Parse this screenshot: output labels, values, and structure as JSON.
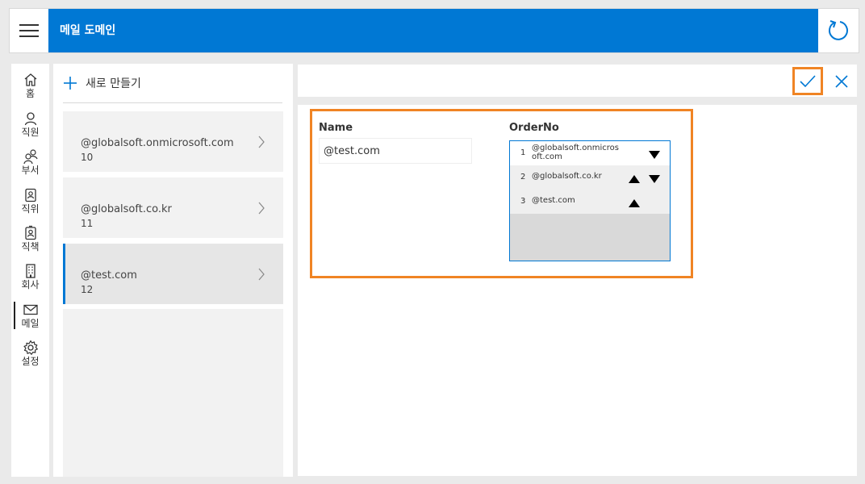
{
  "header": {
    "title": "메일 도메인"
  },
  "rail": {
    "items": [
      {
        "label": "홈",
        "icon": "home-icon"
      },
      {
        "label": "직원",
        "icon": "person-icon"
      },
      {
        "label": "부서",
        "icon": "people-icon"
      },
      {
        "label": "직위",
        "icon": "badge-icon"
      },
      {
        "label": "직책",
        "icon": "role-badge-icon"
      },
      {
        "label": "회사",
        "icon": "building-icon"
      },
      {
        "label": "메일",
        "icon": "mail-icon"
      },
      {
        "label": "설정",
        "icon": "settings-icon"
      }
    ]
  },
  "list": {
    "new_label": "새로 만들기",
    "items": [
      {
        "name": "@globalsoft.onmicrosoft.com",
        "num": "10"
      },
      {
        "name": "@globalsoft.co.kr",
        "num": "11"
      },
      {
        "name": "@test.com",
        "num": "12"
      }
    ]
  },
  "form": {
    "name_label": "Name",
    "name_value": "@test.com",
    "order_label": "OrderNo",
    "order_rows": [
      {
        "idx": "1",
        "text_line1": "@globalsoft.onmicros",
        "text_line2": "oft.com"
      },
      {
        "idx": "2",
        "text_line1": "@globalsoft.co.kr"
      },
      {
        "idx": "3",
        "text_line1": "@test.com"
      }
    ]
  },
  "colors": {
    "accent": "#0078d4",
    "highlight": "#f08424"
  }
}
